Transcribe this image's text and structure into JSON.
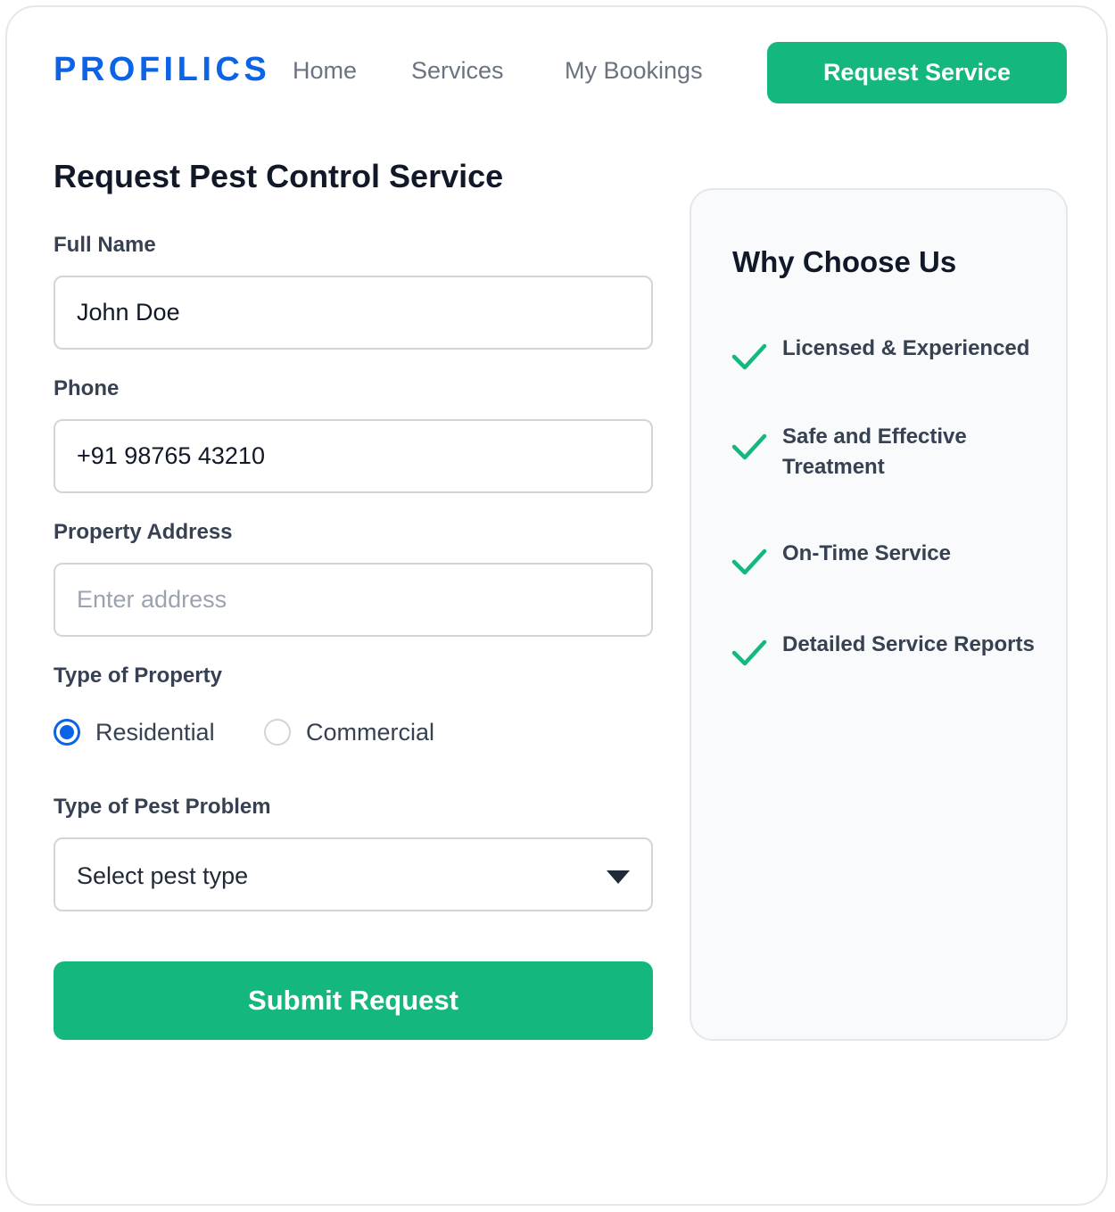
{
  "header": {
    "logo": "PROFILICS",
    "nav": [
      {
        "label": "Home"
      },
      {
        "label": "Services"
      },
      {
        "label": "My Bookings"
      }
    ],
    "cta_label": "Request Service"
  },
  "form": {
    "title": "Request Pest Control Service",
    "full_name": {
      "label": "Full Name",
      "value": "John Doe"
    },
    "phone": {
      "label": "Phone",
      "value": "+91 98765 43210"
    },
    "address": {
      "label": "Property Address",
      "value": "",
      "placeholder": "Enter address"
    },
    "property_type": {
      "label": "Type of Property",
      "options": [
        {
          "label": "Residential",
          "selected": true
        },
        {
          "label": "Commercial",
          "selected": false
        }
      ]
    },
    "pest_type": {
      "label": "Type of Pest Problem",
      "value": "Select pest type"
    },
    "submit_label": "Submit Request"
  },
  "sidebar": {
    "title": "Why Choose Us",
    "features": [
      {
        "text": "Licensed & Experienced",
        "icon": "check-icon"
      },
      {
        "text": "Safe and Effective Treatment",
        "icon": "check-icon"
      },
      {
        "text": "On-Time Service",
        "icon": "check-icon"
      },
      {
        "text": "Detailed Service Reports",
        "icon": "check-icon"
      }
    ]
  },
  "colors": {
    "brand": "#0b63e6",
    "accent": "#14b87d",
    "check": "#14b87d"
  }
}
